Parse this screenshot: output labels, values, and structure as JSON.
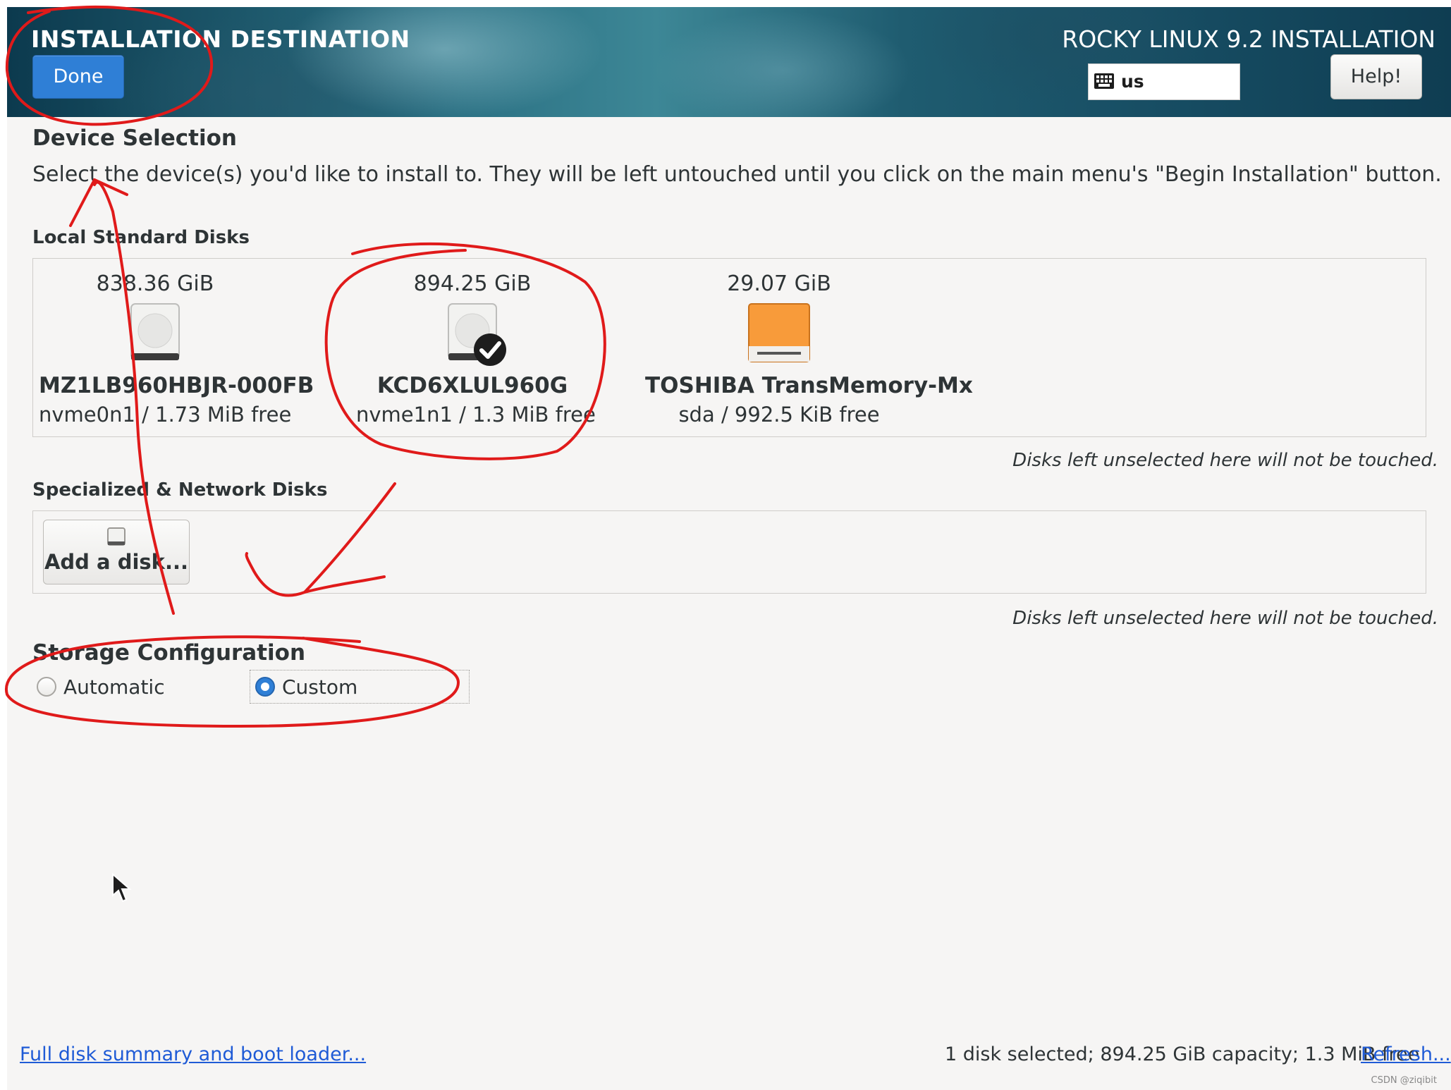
{
  "header": {
    "title": "INSTALLATION DESTINATION",
    "done_label": "Done",
    "product": "ROCKY LINUX 9.2 INSTALLATION",
    "keyboard_layout": "us",
    "help_label": "Help!"
  },
  "device_selection": {
    "heading": "Device Selection",
    "description": "Select the device(s) you'd like to install to.  They will be left untouched until you click on the main menu's \"Begin Installation\" button."
  },
  "local_disks": {
    "heading": "Local Standard Disks",
    "disks": [
      {
        "size": "838.36 GiB",
        "name": "MZ1LB960HBJR-000FB",
        "info": "nvme0n1  /  1.73 MiB free",
        "selected": false,
        "icon": "hard-disk-icon"
      },
      {
        "size": "894.25 GiB",
        "name": "KCD6XLUL960G",
        "info": "nvme1n1  /  1.3 MiB free",
        "selected": true,
        "icon": "hard-disk-icon"
      },
      {
        "size": "29.07 GiB",
        "name": "TOSHIBA TransMemory-Mx",
        "info": "sda    /    992.5 KiB free",
        "selected": false,
        "icon": "usb-drive-icon"
      }
    ],
    "note": "Disks left unselected here will not be touched."
  },
  "specialized_disks": {
    "heading": "Specialized & Network Disks",
    "add_label": "Add a disk...",
    "note": "Disks left unselected here will not be touched."
  },
  "storage_config": {
    "heading": "Storage Configuration",
    "options": [
      {
        "label": "Automatic",
        "selected": false
      },
      {
        "label": "Custom",
        "selected": true
      }
    ]
  },
  "footer": {
    "summary_link": "Full disk summary and boot loader...",
    "status": "1 disk selected; 894.25 GiB capacity; 1.3 MiB free",
    "refresh_link": "Refresh..."
  },
  "watermark": "CSDN @ziqibit",
  "colors": {
    "accent": "#2f7fd6",
    "usb_drive": "#f89b3a",
    "annotation": "#e01a1a",
    "link": "#1f5bd6"
  }
}
